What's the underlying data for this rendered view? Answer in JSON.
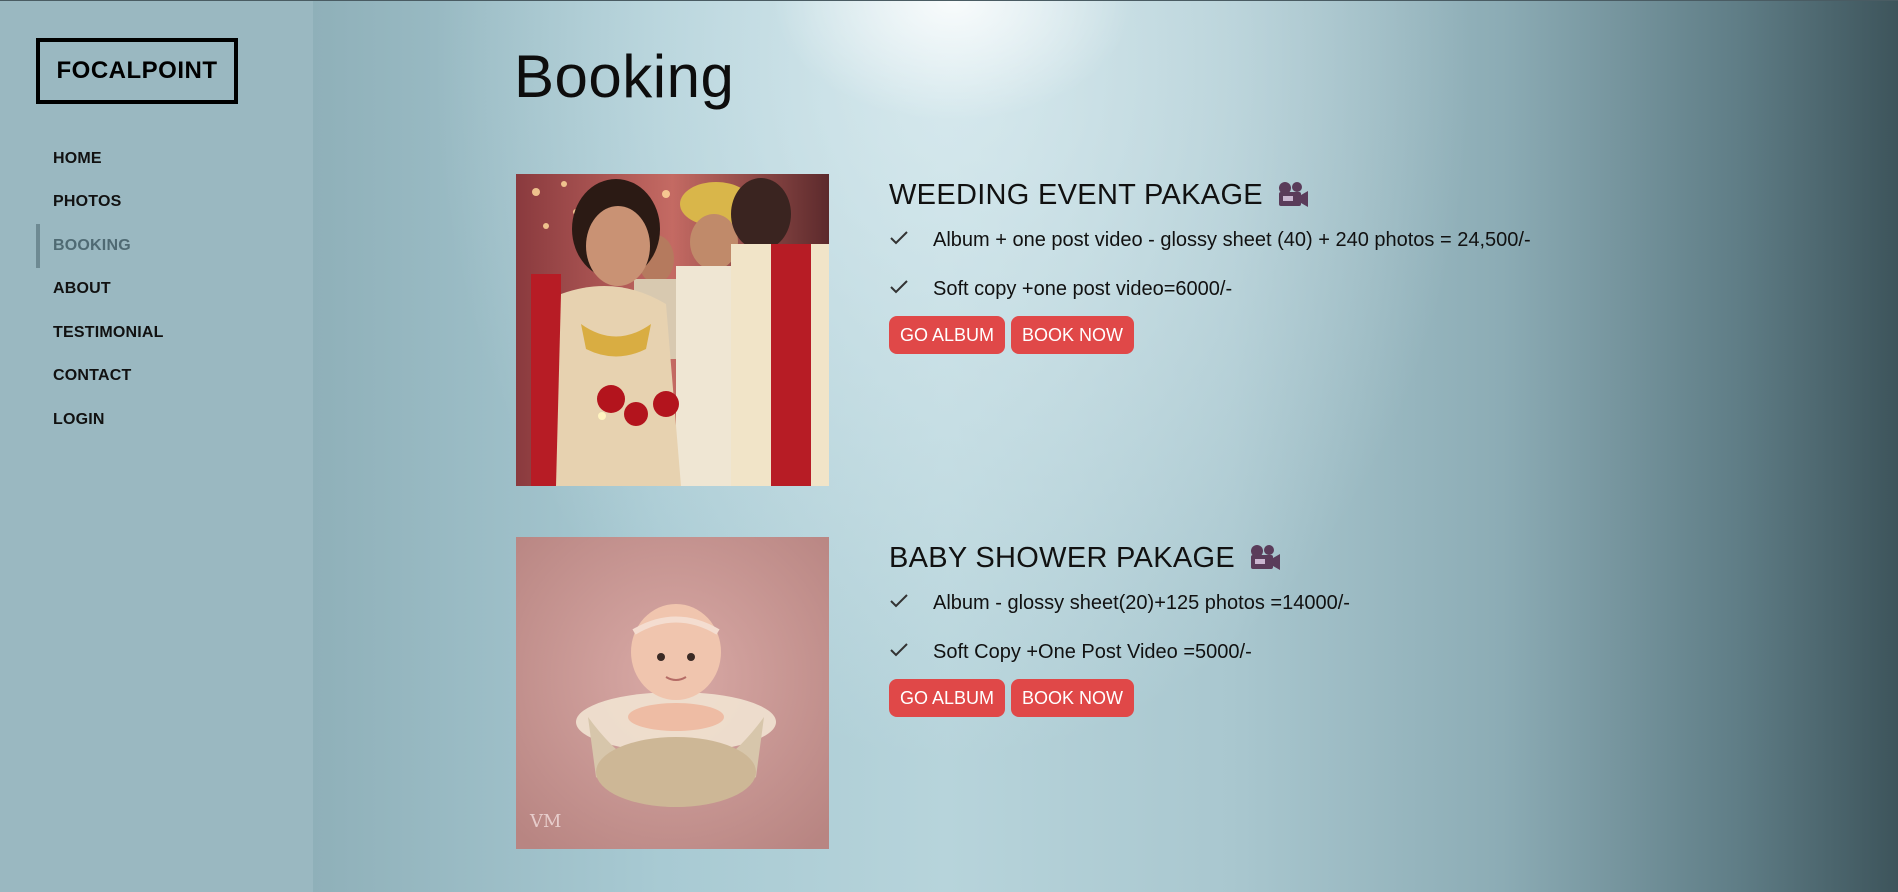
{
  "brand": {
    "logo_text": "FOCALPOINT"
  },
  "nav": {
    "items": [
      {
        "label": "HOME",
        "active": false
      },
      {
        "label": "PHOTOS",
        "active": false
      },
      {
        "label": "BOOKING",
        "active": true
      },
      {
        "label": "ABOUT",
        "active": false
      },
      {
        "label": "TESTIMONIAL",
        "active": false
      },
      {
        "label": "CONTACT",
        "active": false
      },
      {
        "label": "LOGIN",
        "active": false
      }
    ]
  },
  "page": {
    "title": "Booking"
  },
  "packages": [
    {
      "title": "WEEDING EVENT PAKAGE",
      "icon": "movie-camera-icon",
      "features": [
        "Album + one post video - glossy sheet (40) + 240 photos = 24,500/-",
        "Soft copy +one post video=6000/-"
      ],
      "buttons": {
        "album": "GO ALBUM",
        "book": "BOOK NOW"
      }
    },
    {
      "title": "BABY SHOWER PAKAGE",
      "icon": "movie-camera-icon",
      "features": [
        "Album - glossy sheet(20)+125 photos =14000/-",
        "Soft Copy +One Post Video =5000/-"
      ],
      "buttons": {
        "album": "GO ALBUM",
        "book": "BOOK NOW"
      }
    }
  ],
  "colors": {
    "accent_button": "#e04848",
    "sidebar_bg": "#9ab8c1",
    "active_nav": "#4f6a73"
  }
}
